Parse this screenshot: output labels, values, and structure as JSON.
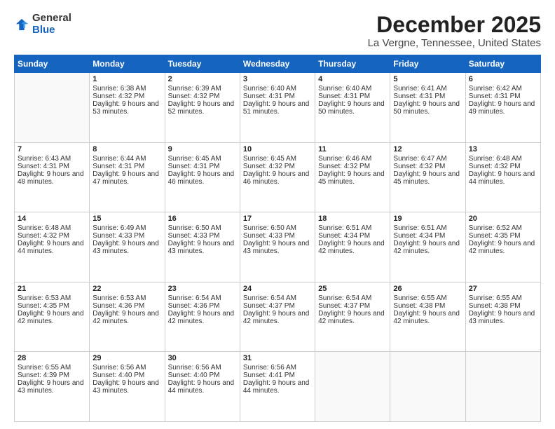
{
  "logo": {
    "general": "General",
    "blue": "Blue"
  },
  "header": {
    "month": "December 2025",
    "location": "La Vergne, Tennessee, United States"
  },
  "days_of_week": [
    "Sunday",
    "Monday",
    "Tuesday",
    "Wednesday",
    "Thursday",
    "Friday",
    "Saturday"
  ],
  "weeks": [
    [
      {
        "day": "",
        "sunrise": "",
        "sunset": "",
        "daylight": ""
      },
      {
        "day": "1",
        "sunrise": "Sunrise: 6:38 AM",
        "sunset": "Sunset: 4:32 PM",
        "daylight": "Daylight: 9 hours and 53 minutes."
      },
      {
        "day": "2",
        "sunrise": "Sunrise: 6:39 AM",
        "sunset": "Sunset: 4:32 PM",
        "daylight": "Daylight: 9 hours and 52 minutes."
      },
      {
        "day": "3",
        "sunrise": "Sunrise: 6:40 AM",
        "sunset": "Sunset: 4:31 PM",
        "daylight": "Daylight: 9 hours and 51 minutes."
      },
      {
        "day": "4",
        "sunrise": "Sunrise: 6:40 AM",
        "sunset": "Sunset: 4:31 PM",
        "daylight": "Daylight: 9 hours and 50 minutes."
      },
      {
        "day": "5",
        "sunrise": "Sunrise: 6:41 AM",
        "sunset": "Sunset: 4:31 PM",
        "daylight": "Daylight: 9 hours and 50 minutes."
      },
      {
        "day": "6",
        "sunrise": "Sunrise: 6:42 AM",
        "sunset": "Sunset: 4:31 PM",
        "daylight": "Daylight: 9 hours and 49 minutes."
      }
    ],
    [
      {
        "day": "7",
        "sunrise": "Sunrise: 6:43 AM",
        "sunset": "Sunset: 4:31 PM",
        "daylight": "Daylight: 9 hours and 48 minutes."
      },
      {
        "day": "8",
        "sunrise": "Sunrise: 6:44 AM",
        "sunset": "Sunset: 4:31 PM",
        "daylight": "Daylight: 9 hours and 47 minutes."
      },
      {
        "day": "9",
        "sunrise": "Sunrise: 6:45 AM",
        "sunset": "Sunset: 4:31 PM",
        "daylight": "Daylight: 9 hours and 46 minutes."
      },
      {
        "day": "10",
        "sunrise": "Sunrise: 6:45 AM",
        "sunset": "Sunset: 4:32 PM",
        "daylight": "Daylight: 9 hours and 46 minutes."
      },
      {
        "day": "11",
        "sunrise": "Sunrise: 6:46 AM",
        "sunset": "Sunset: 4:32 PM",
        "daylight": "Daylight: 9 hours and 45 minutes."
      },
      {
        "day": "12",
        "sunrise": "Sunrise: 6:47 AM",
        "sunset": "Sunset: 4:32 PM",
        "daylight": "Daylight: 9 hours and 45 minutes."
      },
      {
        "day": "13",
        "sunrise": "Sunrise: 6:48 AM",
        "sunset": "Sunset: 4:32 PM",
        "daylight": "Daylight: 9 hours and 44 minutes."
      }
    ],
    [
      {
        "day": "14",
        "sunrise": "Sunrise: 6:48 AM",
        "sunset": "Sunset: 4:32 PM",
        "daylight": "Daylight: 9 hours and 44 minutes."
      },
      {
        "day": "15",
        "sunrise": "Sunrise: 6:49 AM",
        "sunset": "Sunset: 4:33 PM",
        "daylight": "Daylight: 9 hours and 43 minutes."
      },
      {
        "day": "16",
        "sunrise": "Sunrise: 6:50 AM",
        "sunset": "Sunset: 4:33 PM",
        "daylight": "Daylight: 9 hours and 43 minutes."
      },
      {
        "day": "17",
        "sunrise": "Sunrise: 6:50 AM",
        "sunset": "Sunset: 4:33 PM",
        "daylight": "Daylight: 9 hours and 43 minutes."
      },
      {
        "day": "18",
        "sunrise": "Sunrise: 6:51 AM",
        "sunset": "Sunset: 4:34 PM",
        "daylight": "Daylight: 9 hours and 42 minutes."
      },
      {
        "day": "19",
        "sunrise": "Sunrise: 6:51 AM",
        "sunset": "Sunset: 4:34 PM",
        "daylight": "Daylight: 9 hours and 42 minutes."
      },
      {
        "day": "20",
        "sunrise": "Sunrise: 6:52 AM",
        "sunset": "Sunset: 4:35 PM",
        "daylight": "Daylight: 9 hours and 42 minutes."
      }
    ],
    [
      {
        "day": "21",
        "sunrise": "Sunrise: 6:53 AM",
        "sunset": "Sunset: 4:35 PM",
        "daylight": "Daylight: 9 hours and 42 minutes."
      },
      {
        "day": "22",
        "sunrise": "Sunrise: 6:53 AM",
        "sunset": "Sunset: 4:36 PM",
        "daylight": "Daylight: 9 hours and 42 minutes."
      },
      {
        "day": "23",
        "sunrise": "Sunrise: 6:54 AM",
        "sunset": "Sunset: 4:36 PM",
        "daylight": "Daylight: 9 hours and 42 minutes."
      },
      {
        "day": "24",
        "sunrise": "Sunrise: 6:54 AM",
        "sunset": "Sunset: 4:37 PM",
        "daylight": "Daylight: 9 hours and 42 minutes."
      },
      {
        "day": "25",
        "sunrise": "Sunrise: 6:54 AM",
        "sunset": "Sunset: 4:37 PM",
        "daylight": "Daylight: 9 hours and 42 minutes."
      },
      {
        "day": "26",
        "sunrise": "Sunrise: 6:55 AM",
        "sunset": "Sunset: 4:38 PM",
        "daylight": "Daylight: 9 hours and 42 minutes."
      },
      {
        "day": "27",
        "sunrise": "Sunrise: 6:55 AM",
        "sunset": "Sunset: 4:38 PM",
        "daylight": "Daylight: 9 hours and 43 minutes."
      }
    ],
    [
      {
        "day": "28",
        "sunrise": "Sunrise: 6:55 AM",
        "sunset": "Sunset: 4:39 PM",
        "daylight": "Daylight: 9 hours and 43 minutes."
      },
      {
        "day": "29",
        "sunrise": "Sunrise: 6:56 AM",
        "sunset": "Sunset: 4:40 PM",
        "daylight": "Daylight: 9 hours and 43 minutes."
      },
      {
        "day": "30",
        "sunrise": "Sunrise: 6:56 AM",
        "sunset": "Sunset: 4:40 PM",
        "daylight": "Daylight: 9 hours and 44 minutes."
      },
      {
        "day": "31",
        "sunrise": "Sunrise: 6:56 AM",
        "sunset": "Sunset: 4:41 PM",
        "daylight": "Daylight: 9 hours and 44 minutes."
      },
      {
        "day": "",
        "sunrise": "",
        "sunset": "",
        "daylight": ""
      },
      {
        "day": "",
        "sunrise": "",
        "sunset": "",
        "daylight": ""
      },
      {
        "day": "",
        "sunrise": "",
        "sunset": "",
        "daylight": ""
      }
    ]
  ]
}
